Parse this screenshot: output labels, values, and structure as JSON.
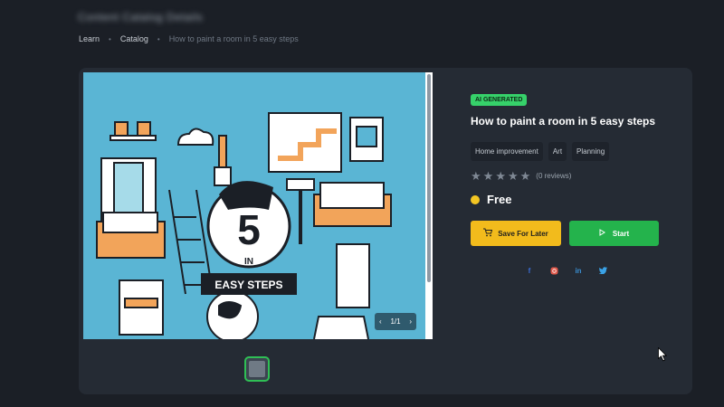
{
  "header": {
    "title": "Content Catalog Details"
  },
  "breadcrumb": {
    "learn": "Learn",
    "catalog": "Catalog",
    "current": "How to paint a room in 5 easy steps"
  },
  "media": {
    "pager": "1/1",
    "illustration": {
      "number": "5",
      "word": "IN",
      "banner": "EASY STEPS"
    }
  },
  "course": {
    "badge": "AI GENERATED",
    "title": "How to paint a room in 5 easy steps",
    "tags": [
      "Home improvement",
      "Art",
      "Planning"
    ],
    "rating": {
      "stars": 5,
      "filled": 0,
      "reviews_text": "(0 reviews)"
    },
    "price": "Free",
    "save_label": "Save For Later",
    "start_label": "Start"
  },
  "colors": {
    "badge": "#36d16a",
    "save": "#f2bb1c",
    "start": "#24b34c",
    "facebook": "#3b6ed6",
    "instagram": "#e0584a",
    "linkedin": "#3a8ed0",
    "twitter": "#3aa2e6"
  },
  "social": [
    "facebook-icon",
    "instagram-icon",
    "linkedin-icon",
    "twitter-icon"
  ]
}
